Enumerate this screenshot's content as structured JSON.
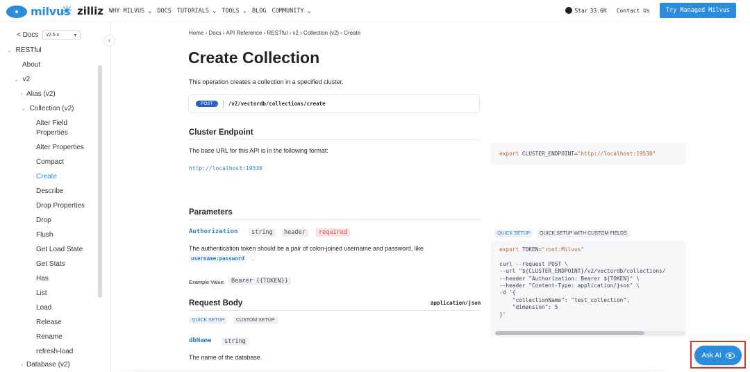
{
  "nav": {
    "logo_milvus": "milvus",
    "logo_zilliz": "zilliz",
    "links": [
      "WHY MILVUS ⌄",
      "DOCS",
      "TUTORIALS ⌄",
      "TOOLS ⌄",
      "BLOG",
      "COMMUNITY ⌄"
    ],
    "github_label": "Star",
    "github_count": "33.6K",
    "contact": "Contact Us",
    "try_button": "Try Managed Milvus"
  },
  "sidebar": {
    "back": "< Docs",
    "version": "v2.5.x",
    "items": [
      {
        "label": "RESTful",
        "caret": "⌄"
      },
      {
        "label": "About"
      },
      {
        "label": "v2",
        "caret": "⌄"
      },
      {
        "label": "Alias (v2)",
        "caret": "›"
      },
      {
        "label": "Collection (v2)",
        "caret": "⌄"
      },
      {
        "label": "Alter Field"
      },
      {
        "label": "Properties"
      },
      {
        "label": "Alter Properties"
      },
      {
        "label": "Compact"
      },
      {
        "label": "Create"
      },
      {
        "label": "Describe"
      },
      {
        "label": "Drop Properties"
      },
      {
        "label": "Drop"
      },
      {
        "label": "Flush"
      },
      {
        "label": "Get Load State"
      },
      {
        "label": "Get Stats"
      },
      {
        "label": "Has"
      },
      {
        "label": "List"
      },
      {
        "label": "Load"
      },
      {
        "label": "Release"
      },
      {
        "label": "Rename"
      },
      {
        "label": "refresh-load"
      },
      {
        "label": "Database (v2)",
        "caret": "›"
      }
    ]
  },
  "main": {
    "breadcrumb": "Home › Docs › API Reference › RESTful › v2 › Collection (v2) › Create",
    "title": "Create Collection",
    "description": "This operation creates a collection in a specified cluster.",
    "method": "POST",
    "path": "/v2/vectordb/collections/create",
    "cluster_heading": "Cluster Endpoint",
    "cluster_text": "The base URL for this API is in the following format:",
    "cluster_url": "http://localhost:19530",
    "params_heading": "Parameters",
    "auth_name": "Authorization",
    "auth_tags": [
      "string",
      "header",
      "required"
    ],
    "auth_desc": "The authentication token should be a pair of colon-joined username and password, like",
    "auth_example_code": "username:password",
    "auth_period": ".",
    "example_label": "Example Value:",
    "example_value": "Bearer {{TOKEN}}",
    "body_heading": "Request Body",
    "body_type": "application/json",
    "body_tabs": [
      "QUICK SETUP",
      "CUSTOM SETUP"
    ],
    "dbname": "dbName",
    "dbname_type": "string",
    "dbname_desc": "The name of the database."
  },
  "right": {
    "endpoint_code_kw": "export",
    "endpoint_code_var": " CLUSTER_ENDPOINT=",
    "endpoint_code_str": "\"http://localhost:19530\"",
    "tabs": [
      "QUICK SETUP",
      "QUICK SETUP WITH CUSTOM FIELDS"
    ],
    "token_kw": "export",
    "token_var": " TOKEN=",
    "token_str": "\"root:Milvus\"",
    "curl_lines": [
      "curl --request POST \\",
      "--url \"${CLUSTER_ENDPOINT}/v2/vectordb/collections/",
      "--header \"Authorization: Bearer ${TOKEN}\" \\",
      "--header \"Content-Type: application/json\" \\",
      "-d '{",
      "    \"collectionName\": \"test_collection\",",
      "    \"dimension\": 5",
      "}'"
    ]
  },
  "askai": {
    "label": "Ask AI"
  }
}
